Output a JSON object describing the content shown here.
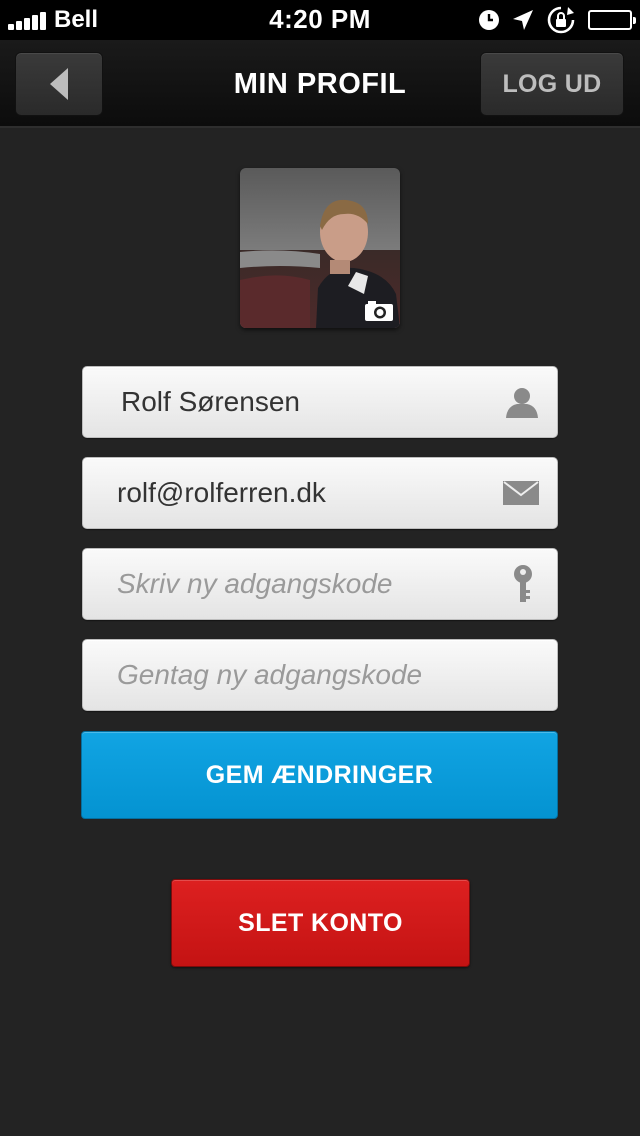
{
  "status_bar": {
    "carrier": "Bell",
    "time": "4:20 PM",
    "signal_bars": 5,
    "battery_level": 1.0,
    "icons": [
      "signal-icon",
      "clock-icon",
      "location-arrow-icon",
      "rotation-lock-icon",
      "battery-icon"
    ]
  },
  "nav": {
    "title": "MIN PROFIL",
    "back_icon": "back-arrow-icon",
    "logout_label": "LOG UD"
  },
  "profile": {
    "avatar_badge_icon": "camera-icon"
  },
  "form": {
    "name": {
      "value": "Rolf Sørensen",
      "icon": "person-icon"
    },
    "email": {
      "value": "rolf@rolferren.dk",
      "icon": "envelope-icon"
    },
    "new_password": {
      "placeholder": "Skriv ny adgangskode",
      "icon": "key-icon"
    },
    "repeat_password": {
      "placeholder": "Gentag ny adgangskode"
    },
    "save_label": "GEM ÆNDRINGER",
    "delete_label": "SLET KONTO"
  },
  "colors": {
    "background": "#232323",
    "save_button": "#0a9bdb",
    "delete_button": "#d41a1a",
    "nav_bar": "#111111"
  }
}
